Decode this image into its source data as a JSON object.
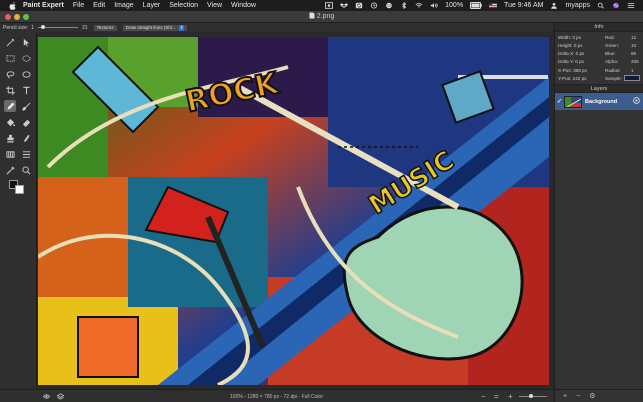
{
  "menubar": {
    "app_name": "Paint Expert",
    "items": [
      "File",
      "Edit",
      "Image",
      "Layer",
      "Selection",
      "View",
      "Window"
    ],
    "battery": "100%",
    "clock": "Tue 9:46 AM",
    "user": "myapps"
  },
  "window": {
    "title": "2.png"
  },
  "toolbar": {
    "pencil_size_label": "Pencil size:",
    "pencil_size_min": "1",
    "pencil_size_value": "21",
    "textures_label": "Textures",
    "line_mode": "Draw straight lines (Shi..."
  },
  "info": {
    "title": "Info",
    "rows": [
      {
        "label": "Width:",
        "value": "0 px",
        "clabel": "Red:",
        "cvalue": "12"
      },
      {
        "label": "Height:",
        "value": "0 px",
        "clabel": "Green:",
        "cvalue": "10"
      },
      {
        "label": "Delta X:",
        "value": "0 px",
        "clabel": "Blue:",
        "cvalue": "86"
      },
      {
        "label": "Delta Y:",
        "value": "0 px",
        "clabel": "Alpha:",
        "cvalue": "255"
      },
      {
        "label": "X-Pos:",
        "value": "388 px",
        "clabel": "Radius:",
        "cvalue": "1"
      },
      {
        "label": "Y-Pos:",
        "value": "242 px",
        "clabel": "Sample:",
        "cvalue": ""
      }
    ],
    "sample_color": "#0d1a3c"
  },
  "layers": {
    "title": "Layers",
    "items": [
      {
        "name": "Background",
        "visible": true
      }
    ]
  },
  "status": {
    "text": "100% - 1280 × 780 px - 72 dpi - Full Color"
  },
  "colors": {
    "accent": "#2d6cdf",
    "layer_selected": "#3e5d8f"
  }
}
